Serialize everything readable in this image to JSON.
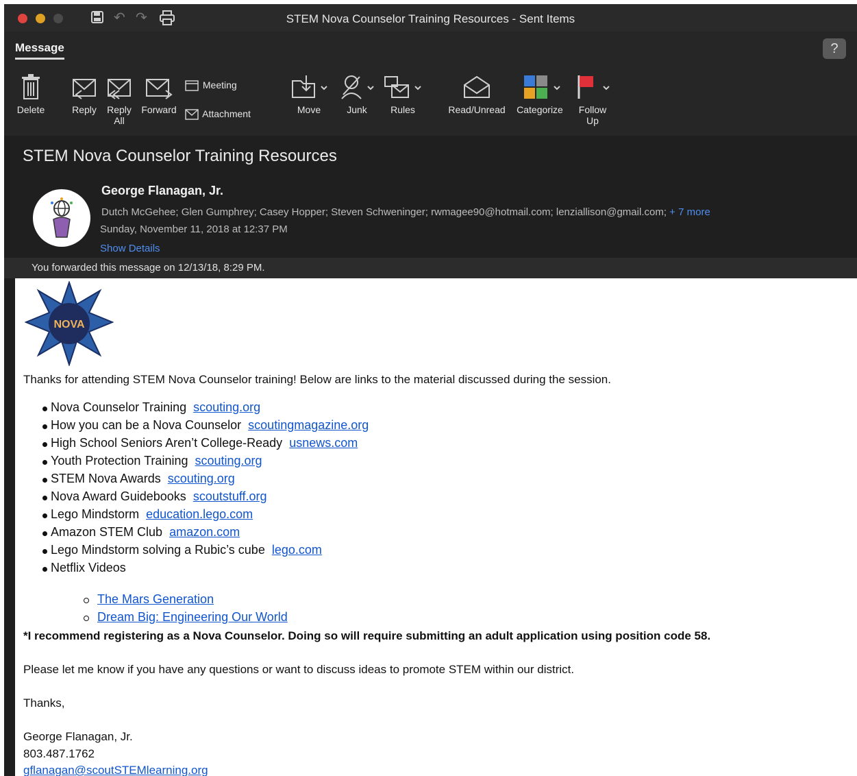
{
  "window": {
    "title": "STEM Nova Counselor Training Resources - Sent Items"
  },
  "tabs": {
    "message": "Message"
  },
  "help": {
    "label": "?"
  },
  "ribbon": {
    "delete": "Delete",
    "reply": "Reply",
    "reply_all_1": "Reply",
    "reply_all_2": "All",
    "forward": "Forward",
    "meeting": "Meeting",
    "attachment": "Attachment",
    "move": "Move",
    "junk": "Junk",
    "rules": "Rules",
    "read_unread": "Read/Unread",
    "categorize": "Categorize",
    "follow_up_1": "Follow",
    "follow_up_2": "Up"
  },
  "message": {
    "subject": "STEM Nova Counselor Training Resources",
    "sender": "George Flanagan, Jr.",
    "recipients": "Dutch McGehee;  Glen Gumphrey;  Casey Hopper;  Steven Schweninger;  rwmagee90@hotmail.com;  lenziallison@gmail.com;",
    "more": "+ 7 more",
    "date": "Sunday, November 11, 2018 at 12:37 PM",
    "show_details": "Show Details",
    "forwarded_note": "You forwarded this message on 12/13/18, 8:29 PM."
  },
  "body": {
    "logo_text": "NOVA",
    "intro": "Thanks for attending STEM Nova Counselor training! Below are links to the material discussed during the session.",
    "links": [
      {
        "text": "Nova Counselor Training",
        "link": "scouting.org"
      },
      {
        "text": "How you can be a Nova Counselor",
        "link": "scoutingmagazine.org"
      },
      {
        "text": "High School Seniors Aren’t College-Ready",
        "link": "usnews.com"
      },
      {
        "text": "Youth Protection Training",
        "link": "scouting.org"
      },
      {
        "text": "STEM Nova Awards",
        "link": "scouting.org"
      },
      {
        "text": "Nova Award Guidebooks",
        "link": "scoutstuff.org"
      },
      {
        "text": "Lego Mindstorm",
        "link": "education.lego.com"
      },
      {
        "text": "Amazon STEM Club",
        "link": "amazon.com"
      },
      {
        "text": "Lego Mindstorm solving a Rubic’s cube",
        "link": "lego.com"
      },
      {
        "text": "Netflix Videos",
        "link": ""
      }
    ],
    "netflix": [
      "The Mars Generation",
      "Dream Big:  Engineering Our World"
    ],
    "recommend": "*I recommend registering as a Nova Counselor. Doing so will require submitting an adult application using position code 58.",
    "questions": "Please let me know if you have any questions or want to discuss ideas to promote STEM within our district.",
    "thanks": "Thanks,",
    "sig_name": "George Flanagan, Jr.",
    "sig_phone": "803.487.1762",
    "sig_email": "gflanagan@scoutSTEMlearning.org"
  }
}
